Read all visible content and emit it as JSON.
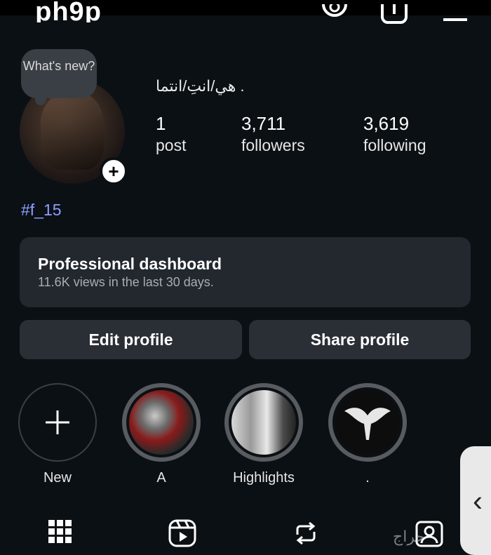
{
  "header": {
    "username": "_ph9p"
  },
  "profile": {
    "note": "What's new?",
    "display_name": ". هي/انتِ/انتما",
    "stats": [
      {
        "value": "1",
        "label": "post"
      },
      {
        "value": "3,711",
        "label": "followers"
      },
      {
        "value": "3,619",
        "label": "following"
      }
    ],
    "bio_hashtag": "#f_15"
  },
  "dashboard": {
    "title": "Professional dashboard",
    "subtitle": "11.6K views in the last 30 days."
  },
  "buttons": {
    "edit": "Edit profile",
    "share": "Share profile"
  },
  "highlights": [
    {
      "label": "New",
      "icon": "plus-icon"
    },
    {
      "label": "A"
    },
    {
      "label": "Highlights"
    },
    {
      "label": "."
    }
  ],
  "tabs": [
    "grid-icon",
    "reels-icon",
    "reposts-icon",
    "tagged-icon"
  ],
  "watermark": "حراج",
  "colors": {
    "background": "#0b1014",
    "card": "#23272e",
    "button": "#2a2f36",
    "link": "#8f9dff"
  }
}
